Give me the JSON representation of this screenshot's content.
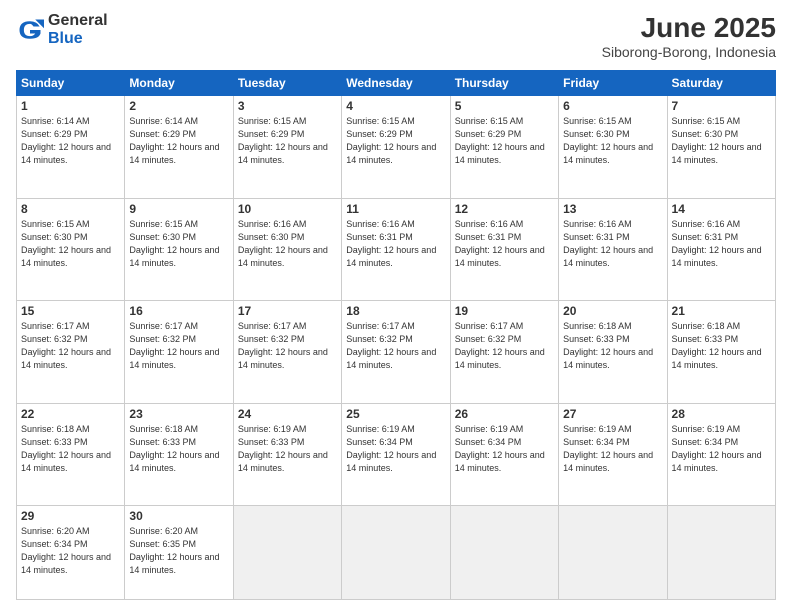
{
  "header": {
    "logo_general": "General",
    "logo_blue": "Blue",
    "month": "June 2025",
    "location": "Siborong-Borong, Indonesia"
  },
  "weekdays": [
    "Sunday",
    "Monday",
    "Tuesday",
    "Wednesday",
    "Thursday",
    "Friday",
    "Saturday"
  ],
  "weeks": [
    [
      {
        "day": 1,
        "sunrise": "6:14 AM",
        "sunset": "6:29 PM",
        "daylight": "12 hours and 14 minutes"
      },
      {
        "day": 2,
        "sunrise": "6:14 AM",
        "sunset": "6:29 PM",
        "daylight": "12 hours and 14 minutes"
      },
      {
        "day": 3,
        "sunrise": "6:15 AM",
        "sunset": "6:29 PM",
        "daylight": "12 hours and 14 minutes"
      },
      {
        "day": 4,
        "sunrise": "6:15 AM",
        "sunset": "6:29 PM",
        "daylight": "12 hours and 14 minutes"
      },
      {
        "day": 5,
        "sunrise": "6:15 AM",
        "sunset": "6:29 PM",
        "daylight": "12 hours and 14 minutes"
      },
      {
        "day": 6,
        "sunrise": "6:15 AM",
        "sunset": "6:30 PM",
        "daylight": "12 hours and 14 minutes"
      },
      {
        "day": 7,
        "sunrise": "6:15 AM",
        "sunset": "6:30 PM",
        "daylight": "12 hours and 14 minutes"
      }
    ],
    [
      {
        "day": 8,
        "sunrise": "6:15 AM",
        "sunset": "6:30 PM",
        "daylight": "12 hours and 14 minutes"
      },
      {
        "day": 9,
        "sunrise": "6:15 AM",
        "sunset": "6:30 PM",
        "daylight": "12 hours and 14 minutes"
      },
      {
        "day": 10,
        "sunrise": "6:16 AM",
        "sunset": "6:30 PM",
        "daylight": "12 hours and 14 minutes"
      },
      {
        "day": 11,
        "sunrise": "6:16 AM",
        "sunset": "6:31 PM",
        "daylight": "12 hours and 14 minutes"
      },
      {
        "day": 12,
        "sunrise": "6:16 AM",
        "sunset": "6:31 PM",
        "daylight": "12 hours and 14 minutes"
      },
      {
        "day": 13,
        "sunrise": "6:16 AM",
        "sunset": "6:31 PM",
        "daylight": "12 hours and 14 minutes"
      },
      {
        "day": 14,
        "sunrise": "6:16 AM",
        "sunset": "6:31 PM",
        "daylight": "12 hours and 14 minutes"
      }
    ],
    [
      {
        "day": 15,
        "sunrise": "6:17 AM",
        "sunset": "6:32 PM",
        "daylight": "12 hours and 14 minutes"
      },
      {
        "day": 16,
        "sunrise": "6:17 AM",
        "sunset": "6:32 PM",
        "daylight": "12 hours and 14 minutes"
      },
      {
        "day": 17,
        "sunrise": "6:17 AM",
        "sunset": "6:32 PM",
        "daylight": "12 hours and 14 minutes"
      },
      {
        "day": 18,
        "sunrise": "6:17 AM",
        "sunset": "6:32 PM",
        "daylight": "12 hours and 14 minutes"
      },
      {
        "day": 19,
        "sunrise": "6:17 AM",
        "sunset": "6:32 PM",
        "daylight": "12 hours and 14 minutes"
      },
      {
        "day": 20,
        "sunrise": "6:18 AM",
        "sunset": "6:33 PM",
        "daylight": "12 hours and 14 minutes"
      },
      {
        "day": 21,
        "sunrise": "6:18 AM",
        "sunset": "6:33 PM",
        "daylight": "12 hours and 14 minutes"
      }
    ],
    [
      {
        "day": 22,
        "sunrise": "6:18 AM",
        "sunset": "6:33 PM",
        "daylight": "12 hours and 14 minutes"
      },
      {
        "day": 23,
        "sunrise": "6:18 AM",
        "sunset": "6:33 PM",
        "daylight": "12 hours and 14 minutes"
      },
      {
        "day": 24,
        "sunrise": "6:19 AM",
        "sunset": "6:33 PM",
        "daylight": "12 hours and 14 minutes"
      },
      {
        "day": 25,
        "sunrise": "6:19 AM",
        "sunset": "6:34 PM",
        "daylight": "12 hours and 14 minutes"
      },
      {
        "day": 26,
        "sunrise": "6:19 AM",
        "sunset": "6:34 PM",
        "daylight": "12 hours and 14 minutes"
      },
      {
        "day": 27,
        "sunrise": "6:19 AM",
        "sunset": "6:34 PM",
        "daylight": "12 hours and 14 minutes"
      },
      {
        "day": 28,
        "sunrise": "6:19 AM",
        "sunset": "6:34 PM",
        "daylight": "12 hours and 14 minutes"
      }
    ],
    [
      {
        "day": 29,
        "sunrise": "6:20 AM",
        "sunset": "6:34 PM",
        "daylight": "12 hours and 14 minutes"
      },
      {
        "day": 30,
        "sunrise": "6:20 AM",
        "sunset": "6:35 PM",
        "daylight": "12 hours and 14 minutes"
      },
      null,
      null,
      null,
      null,
      null
    ]
  ]
}
